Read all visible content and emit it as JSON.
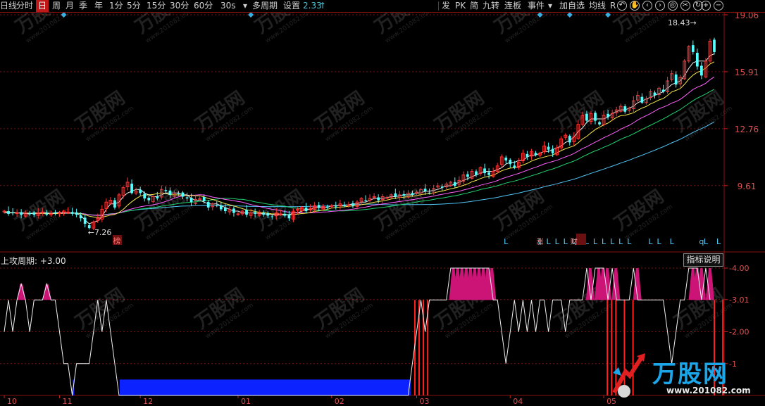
{
  "toolbar": {
    "items": [
      "日线",
      "分时",
      "日",
      "周",
      "月",
      "季",
      "年",
      "1分",
      "5分",
      "15分",
      "30分",
      "60分",
      "30s",
      "多周期",
      "设置"
    ],
    "selected": "日",
    "dropdown_arrow": "▾",
    "price_fragment": "2.33",
    "price_arrow": "↑",
    "right_items": [
      "发",
      "PK",
      "简",
      "九转",
      "连板",
      "事件",
      "加自选",
      "均线",
      "R"
    ],
    "icons": [
      "back-icon",
      "hand-icon",
      "pan-left-icon",
      "pan-right-icon",
      "zoom-in-icon",
      "zoom-out-icon"
    ]
  },
  "indicator": {
    "name": "上攻周期",
    "value": "+3.00",
    "help_label": "指标说明"
  },
  "markers": {
    "low_label": "7.26",
    "high_label": "18.43",
    "bang_label": "榜",
    "lhb": [
      "涨",
      "财"
    ],
    "letter": "L",
    "q": "q"
  },
  "watermark": {
    "brand": "万股网",
    "url": "www.201082.com"
  },
  "logo": {
    "brand": "万股网",
    "url": "www.201082.com"
  },
  "colors": {
    "up": "#ff3333",
    "down": "#54ffff",
    "ma5": "#f0f0f0",
    "ma10": "#f5e84a",
    "ma20": "#ff60ff",
    "ma30": "#1fd36f",
    "ma60": "#4fc4f4",
    "signal": "#54d0ff"
  },
  "chart_data": [
    {
      "type": "candlestick",
      "title": "",
      "y_axis_labels": [
        "19.06",
        "15.91",
        "12.76",
        "9.61"
      ],
      "ylim": [
        6.45,
        19.06
      ],
      "x_axis_labels": [
        "10",
        "11",
        "12",
        "01",
        "02",
        "03",
        "04",
        "05"
      ],
      "annotations": [
        "7.26",
        "18.43",
        "榜"
      ],
      "series": [
        {
          "kind": "close",
          "values": [
            8.2,
            8.05,
            8.1,
            8.1,
            8.0,
            8.1,
            8.05,
            8.0,
            8.1,
            8.15,
            8.0,
            8.05,
            8.1,
            8.1,
            8.2,
            8.15,
            8.05,
            8.0,
            7.8,
            7.5,
            7.26,
            7.6,
            7.8,
            8.3,
            8.7,
            8.8,
            8.4,
            9.1,
            9.5,
            9.8,
            9.2,
            9.3,
            9.2,
            8.9,
            8.8,
            9.0,
            8.9,
            9.4,
            9.3,
            9.1,
            9.2,
            9.15,
            9.0,
            8.9,
            8.7,
            8.85,
            8.9,
            8.75,
            8.4,
            8.6,
            8.5,
            8.3,
            8.2,
            8.3,
            8.1,
            8.05,
            8.2,
            8.0,
            8.1,
            8.05,
            8.1,
            8.0,
            7.95,
            7.9,
            8.1,
            8.05,
            7.95,
            7.8,
            8.2,
            8.3,
            8.4,
            8.2,
            8.35,
            8.5,
            8.4,
            8.45,
            8.4,
            8.5,
            8.45,
            8.6,
            8.5,
            8.55,
            8.5,
            8.7,
            8.9,
            8.8,
            8.9,
            9.0,
            8.8,
            9.0,
            8.95,
            9.1,
            9.0,
            9.1,
            9.05,
            9.2,
            9.1,
            9.25,
            9.4,
            9.3,
            9.2,
            9.45,
            9.6,
            9.5,
            9.7,
            9.8,
            9.6,
            9.9,
            10.2,
            10.1,
            10.4,
            10.2,
            10.6,
            10.3,
            10.2,
            10.4,
            10.7,
            11.2,
            11.0,
            10.8,
            10.6,
            10.9,
            11.4,
            11.2,
            11.5,
            11.3,
            11.4,
            11.8,
            11.6,
            11.4,
            11.7,
            12.2,
            12.4,
            12.0,
            12.3,
            13.0,
            13.5,
            13.2,
            13.6,
            13.2,
            13.0,
            13.5,
            13.4,
            13.6,
            13.8,
            14.0,
            13.7,
            13.9,
            14.3,
            14.6,
            14.2,
            14.4,
            14.8,
            14.6,
            15.0,
            14.8,
            15.4,
            15.8,
            15.2,
            15.6,
            16.5,
            17.3,
            17.0,
            16.2,
            15.7,
            16.5,
            17.6,
            17.0
          ]
        },
        {
          "kind": "MA5",
          "values": [
            8.1,
            8.1,
            8.1,
            8.1,
            8.1,
            8.06,
            8.04,
            8.1,
            8.1,
            8.11,
            8.1,
            8.07,
            8.11,
            8.13,
            8.08,
            8.09,
            8.1,
            8.07,
            7.97,
            7.7,
            7.5,
            7.6,
            7.65,
            7.9,
            8.3,
            8.6,
            8.6,
            8.7,
            9.0,
            9.2,
            9.3,
            9.4,
            9.4,
            9.2,
            9.1,
            9.0,
            9.0,
            9.1,
            9.2,
            9.2,
            9.2,
            9.2,
            9.1,
            9.1,
            8.9,
            8.8,
            8.8,
            8.7,
            8.6,
            8.6,
            8.6,
            8.5,
            8.4,
            8.3,
            8.2,
            8.2,
            8.1,
            8.1,
            8.1,
            8.1,
            8.07,
            8.05,
            8.03,
            8.0,
            8.0,
            8.0,
            8.0,
            8.0,
            8.1,
            8.1,
            8.2,
            8.3,
            8.3,
            8.4,
            8.4,
            8.4,
            8.4,
            8.5,
            8.5,
            8.5,
            8.5,
            8.55,
            8.6,
            8.6,
            8.7,
            8.7,
            8.8,
            8.9,
            8.9,
            8.9,
            8.95,
            9.0,
            9.0,
            9.05,
            9.1,
            9.1,
            9.1,
            9.2,
            9.2,
            9.3,
            9.3,
            9.35,
            9.4,
            9.5,
            9.6,
            9.6,
            9.7,
            9.8,
            9.9,
            10.0,
            10.1,
            10.2,
            10.3,
            10.4,
            10.4,
            10.4,
            10.5,
            10.6,
            10.8,
            10.9,
            10.9,
            11.0,
            11.0,
            11.2,
            11.3,
            11.3,
            11.4,
            11.5,
            11.5,
            11.6,
            11.7,
            11.8,
            12.0,
            12.1,
            12.3,
            12.6,
            12.8,
            13.1,
            13.3,
            13.3,
            13.3,
            13.3,
            13.4,
            13.6,
            13.7,
            13.8,
            13.8,
            13.9,
            14.0,
            14.2,
            14.3,
            14.4,
            14.5,
            14.6,
            14.7,
            14.8,
            15.0,
            15.2,
            15.3,
            15.4,
            15.7,
            16.1,
            16.4,
            16.5,
            16.5,
            16.5,
            16.8,
            16.9
          ]
        }
      ]
    },
    {
      "type": "line",
      "title": "上攻周期",
      "y_axis_labels": [
        "4.00",
        "3.01",
        "2.00",
        "1"
      ],
      "ylim": [
        0,
        4.4
      ],
      "series": [
        {
          "name": "上攻周期",
          "values": [
            2,
            3,
            2,
            3,
            3.5,
            3,
            2,
            3,
            3,
            3,
            3.5,
            3,
            3,
            2,
            1,
            1,
            0,
            1,
            1,
            1,
            1,
            2,
            3,
            2,
            3,
            2,
            1,
            0,
            0,
            0,
            0,
            0,
            0,
            0,
            0,
            0,
            0,
            0,
            0,
            0,
            0,
            0,
            0,
            0,
            0,
            0,
            0,
            0,
            0,
            0,
            0,
            0,
            0,
            0,
            0,
            0,
            0,
            0,
            0,
            0,
            0,
            0,
            0,
            0,
            0,
            0,
            0,
            0,
            0,
            0,
            0,
            0,
            0,
            0,
            0,
            0,
            0,
            0,
            0,
            0,
            0,
            0,
            0,
            0,
            0,
            0,
            0,
            0,
            0,
            0,
            0,
            0,
            0,
            0,
            0,
            0,
            1,
            2,
            3,
            2,
            3,
            3,
            3,
            3,
            3,
            4,
            4,
            4,
            4,
            4,
            4,
            4,
            4,
            4,
            4,
            3,
            3,
            2,
            1,
            2,
            3,
            2,
            3,
            2,
            3,
            2,
            3,
            3,
            2,
            3,
            3,
            3,
            2,
            3,
            3,
            3,
            3,
            4,
            3,
            4,
            4,
            4,
            3,
            4,
            3,
            3,
            3,
            3,
            4,
            3,
            3,
            3,
            3,
            3,
            3,
            3,
            2,
            1,
            2,
            3,
            3,
            4,
            4,
            4,
            3,
            4,
            3
          ]
        }
      ]
    }
  ]
}
